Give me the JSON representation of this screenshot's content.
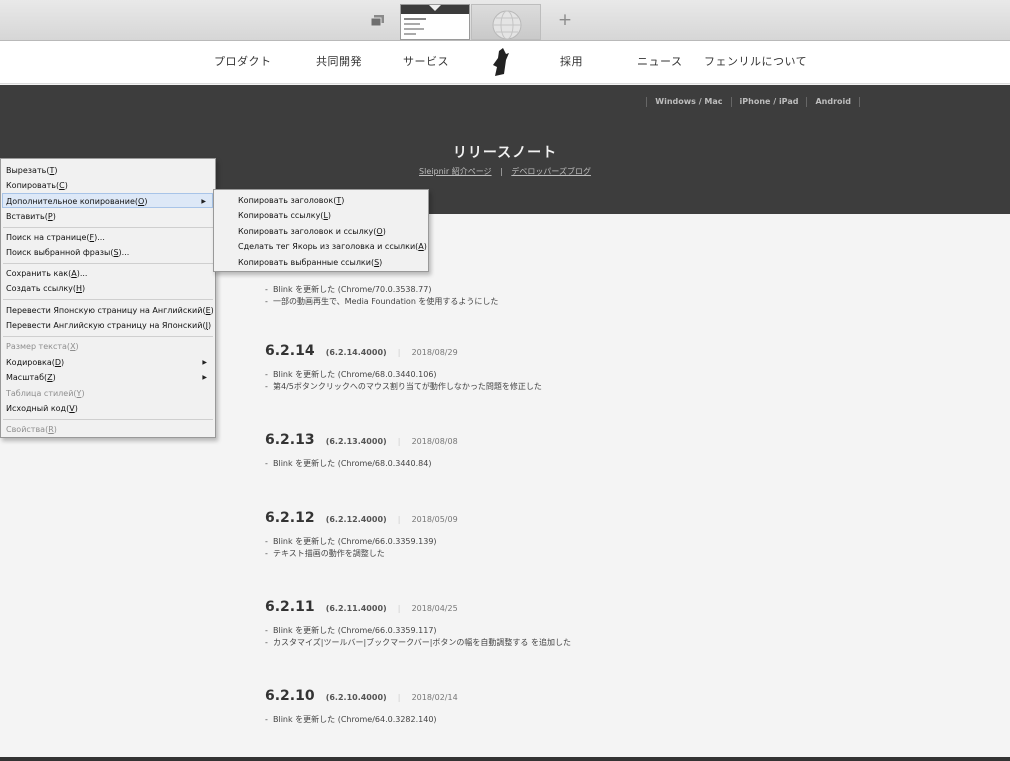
{
  "tabbar": {
    "pages_icon": "tab-pages-icon",
    "add_tab": "+",
    "tabs": [
      {
        "state": "active",
        "icon": "page-thumbnail"
      },
      {
        "state": "inactive",
        "icon": "globe-icon"
      }
    ]
  },
  "nav": {
    "items": [
      "プロダクト",
      "共同開発",
      "サービス",
      "採用",
      "ニュース",
      "フェンリルについて"
    ],
    "logo": "fenrir-wolf-logo"
  },
  "hero": {
    "platforms": [
      "Windows / Mac",
      "iPhone / iPad",
      "Android"
    ],
    "title": "リリースノート",
    "link1": "Sleipnir 紹介ページ",
    "separator": "|",
    "link2": "デベロッパーズブログ"
  },
  "first_release_items": [
    "Blink を更新した (Chrome/70.0.3538.77)",
    "一部の動画再生で、Media Foundation を使用するようにした"
  ],
  "releases": [
    {
      "version": "6.2.14",
      "build": "(6.2.14.4000)",
      "date": "2018/08/29",
      "items": [
        "Blink を更新した (Chrome/68.0.3440.106)",
        "第4/5ボタンクリックへのマウス割り当てが動作しなかった問題を修正した"
      ]
    },
    {
      "version": "6.2.13",
      "build": "(6.2.13.4000)",
      "date": "2018/08/08",
      "items": [
        "Blink を更新した (Chrome/68.0.3440.84)"
      ]
    },
    {
      "version": "6.2.12",
      "build": "(6.2.12.4000)",
      "date": "2018/05/09",
      "items": [
        "Blink を更新した (Chrome/66.0.3359.139)",
        "テキスト描画の動作を調整した"
      ]
    },
    {
      "version": "6.2.11",
      "build": "(6.2.11.4000)",
      "date": "2018/04/25",
      "items": [
        "Blink を更新した (Chrome/66.0.3359.117)",
        "カスタマイズ|ツールバー|ブックマークバー|ボタンの幅を自動調整する を追加した"
      ]
    },
    {
      "version": "6.2.10",
      "build": "(6.2.10.4000)",
      "date": "2018/02/14",
      "items": [
        "Blink を更新した (Chrome/64.0.3282.140)"
      ]
    }
  ],
  "context_menu": {
    "items": [
      {
        "label": "Вырезать(",
        "key": "T",
        "tail": ")",
        "state": "normal"
      },
      {
        "label": "Копировать(",
        "key": "C",
        "tail": ")",
        "state": "normal"
      },
      {
        "label": "Дополнительное копирование(",
        "key": "O",
        "tail": ")",
        "state": "highlighted",
        "submenu": true
      },
      {
        "label": "Вставить(",
        "key": "P",
        "tail": ")",
        "state": "normal"
      },
      {
        "label": "Поиск на странице(",
        "key": "F",
        "tail": ")...",
        "state": "normal"
      },
      {
        "label": "Поиск выбранной фразы(",
        "key": "S",
        "tail": ")...",
        "state": "normal"
      },
      {
        "label": "Сохранить как(",
        "key": "A",
        "tail": ")...",
        "state": "normal"
      },
      {
        "label": "Создать ссылку(",
        "key": "H",
        "tail": ")",
        "state": "normal"
      },
      {
        "label": "Перевести Японскую страницу на Английский(",
        "key": "E",
        "tail": ")",
        "state": "normal"
      },
      {
        "label": "Перевести Английскую страницу на Японский(",
        "key": "J",
        "tail": ")",
        "state": "normal"
      },
      {
        "label": "Размер текста(",
        "key": "X",
        "tail": ")",
        "state": "disabled"
      },
      {
        "label": "Кодировка(",
        "key": "D",
        "tail": ")",
        "state": "normal",
        "submenu": true
      },
      {
        "label": "Масштаб(",
        "key": "Z",
        "tail": ")",
        "state": "normal",
        "submenu": true
      },
      {
        "label": "Таблица стилей(",
        "key": "Y",
        "tail": ")",
        "state": "disabled"
      },
      {
        "label": "Исходный код(",
        "key": "V",
        "tail": ")",
        "state": "normal"
      },
      {
        "label": "Свойства(",
        "key": "R",
        "tail": ")",
        "state": "disabled"
      }
    ],
    "submenu_arrow": "▶"
  },
  "sub_menu": {
    "items": [
      {
        "label": "Копировать заголовок(",
        "key": "T",
        "tail": ")"
      },
      {
        "label": "Копировать ссылку(",
        "key": "L",
        "tail": ")"
      },
      {
        "label": "Копировать заголовок и ссылку(",
        "key": "O",
        "tail": ")"
      },
      {
        "label": "Сделать тег Якорь из заголовка и ссылки(",
        "key": "A",
        "tail": ")"
      },
      {
        "label": "Копировать выбранные ссылки(",
        "key": "S",
        "tail": ")"
      }
    ]
  }
}
